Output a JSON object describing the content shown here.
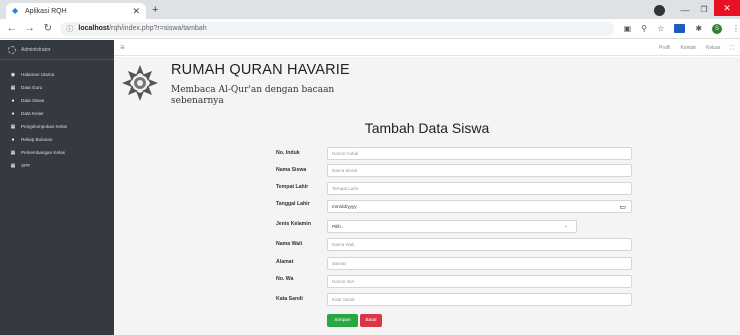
{
  "browser": {
    "tab_title": "Aplikasi RQH",
    "url_host": "localhost",
    "url_path": "/rqh/index.php?r=siswa/tambah"
  },
  "topnav": {
    "items": [
      "Profil",
      "Kontak",
      "Keluar"
    ]
  },
  "sidebar": {
    "user": "Administrator",
    "items": [
      {
        "label": "Halaman Utama",
        "icon": "dashboard-icon"
      },
      {
        "label": "Data Guru",
        "icon": "table-icon"
      },
      {
        "label": "Data Siswa",
        "icon": "user-icon"
      },
      {
        "label": "Data Kelas",
        "icon": "pin-icon"
      },
      {
        "label": "Pengelompokan Kelas",
        "icon": "table-icon"
      },
      {
        "label": "Rekap Bulanan",
        "icon": "info-icon"
      },
      {
        "label": "Perkembangan Kelas",
        "icon": "table-icon"
      },
      {
        "label": "SPP",
        "icon": "table-icon"
      }
    ]
  },
  "banner": {
    "title": "RUMAH QURAN HAVARIE",
    "tagline": "Membaca Al-Qur'an dengan bacaan sebenarnya"
  },
  "form": {
    "title": "Tambah Data Siswa",
    "fields": [
      {
        "label": "No. Induk",
        "placeholder": "Nomor Induk"
      },
      {
        "label": "Nama Siswa",
        "placeholder": "Nama Murid"
      },
      {
        "label": "Tempat Lahir",
        "placeholder": "Tempat Lahir"
      },
      {
        "label": "Tanggal Lahir",
        "placeholder": "mm/dd/yyyy"
      },
      {
        "label": "Jenis Kelamin",
        "placeholder": "Pilih.."
      },
      {
        "label": "Nama Wali",
        "placeholder": "Nama Wali"
      },
      {
        "label": "Alamat",
        "placeholder": "alamat"
      },
      {
        "label": "No. Wa",
        "placeholder": "Nomor WA"
      },
      {
        "label": "Kata Sandi",
        "placeholder": "Kata Sandi"
      }
    ],
    "save_label": "Simpan",
    "reset_label": "Batal"
  }
}
